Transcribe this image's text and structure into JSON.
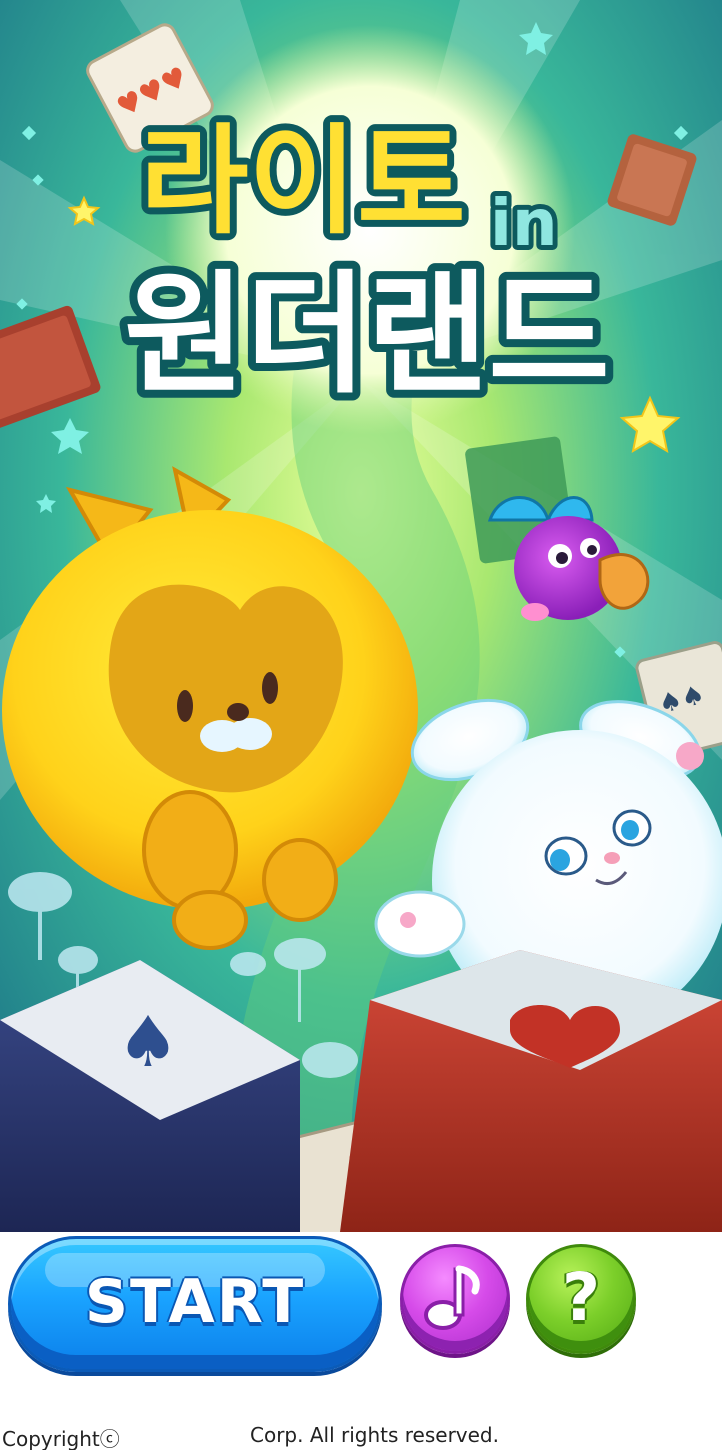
{
  "game": {
    "title_line1": "라이토",
    "title_in": "in",
    "title_line2": "원더랜드"
  },
  "buttons": {
    "start_label": "START",
    "music_icon": "music-note-icon",
    "help_label": "?"
  },
  "footer": {
    "copyright_left": "Copyrightⓒ",
    "copyright_right": "Corp. All rights reserved."
  },
  "colors": {
    "start_button": "#1aa3ff",
    "music_button": "#d64be9",
    "help_button": "#7ccf2a",
    "title_yellow": "#ffe033",
    "title_outline": "#0d5a5e"
  }
}
